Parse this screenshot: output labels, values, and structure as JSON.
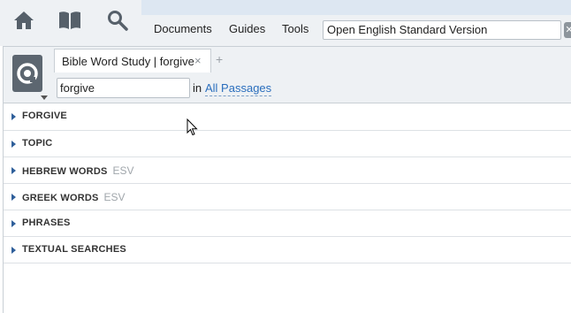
{
  "toolbar": {
    "icons": [
      "home-icon",
      "library-icon",
      "search-icon"
    ],
    "menu": [
      "Documents",
      "Guides",
      "Tools"
    ],
    "resource_search": "Open English Standard Version",
    "clear_label": "✕"
  },
  "panel": {
    "logo_icon": "word-study-icon",
    "tab_title": "Bible Word Study | forgive",
    "tab_close": "×",
    "tab_add": "+",
    "word_value": "forgive",
    "in_label": "in",
    "range_link": "All Passages"
  },
  "sections": [
    {
      "label": "FORGIVE",
      "tag": ""
    },
    {
      "label": "TOPIC",
      "tag": ""
    },
    {
      "label": "HEBREW WORDS",
      "tag": "ESV"
    },
    {
      "label": "GREEK WORDS",
      "tag": "ESV"
    },
    {
      "label": "PHRASES",
      "tag": ""
    },
    {
      "label": "TEXTUAL SEARCHES",
      "tag": ""
    }
  ],
  "colors": {
    "accent": "#2a6ebd",
    "toolbar_bg": "#eef1f4",
    "logo_bg": "#5c6670"
  }
}
